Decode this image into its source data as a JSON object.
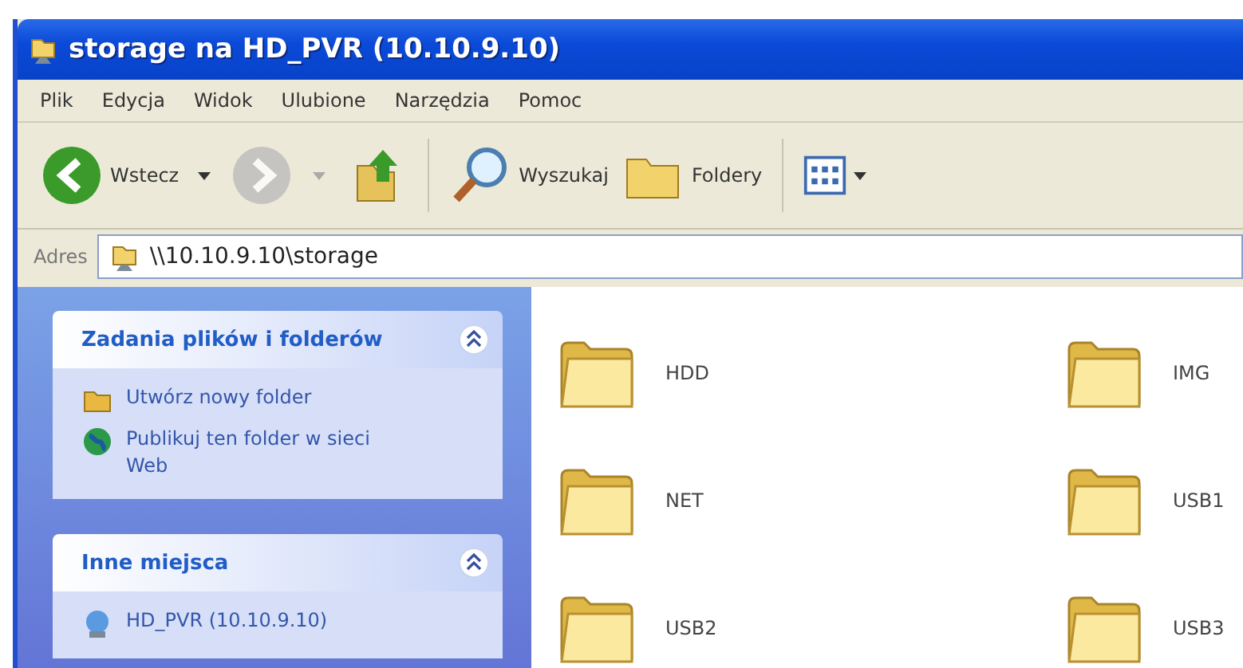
{
  "window": {
    "title": "storage na HD_PVR (10.10.9.10)"
  },
  "menu": [
    "Plik",
    "Edycja",
    "Widok",
    "Ulubione",
    "Narzędzia",
    "Pomoc"
  ],
  "toolbar": [
    {
      "kind": "back",
      "label": "Wstecz",
      "disabled": false
    },
    {
      "kind": "forward",
      "disabled": true
    },
    {
      "kind": "up",
      "disabled": false
    },
    {
      "kind": "separator"
    },
    {
      "kind": "search",
      "label": "Wyszukaj",
      "disabled": false
    },
    {
      "kind": "folders",
      "label": "Foldery",
      "disabled": false
    },
    {
      "kind": "separator"
    },
    {
      "kind": "views",
      "disabled": false
    }
  ],
  "address": {
    "label": "Adres",
    "value": "\\\\10.10.9.10\\storage"
  },
  "sidebar": {
    "panels": [
      {
        "title": "Zadania plików i folderów",
        "expanded": true,
        "items": [
          {
            "kind": "folder",
            "label": "Utwórz nowy folder"
          },
          {
            "kind": "globe",
            "label": "Publikuj ten folder w sieci Web"
          }
        ]
      },
      {
        "title": "Inne miejsca",
        "expanded": true,
        "items": [
          {
            "kind": "computer",
            "label": "HD_PVR (10.10.9.10)"
          }
        ]
      }
    ]
  },
  "folders": [
    {
      "name": "HDD"
    },
    {
      "name": "IMG"
    },
    {
      "name": "NET"
    },
    {
      "name": "USB1"
    },
    {
      "name": "USB2"
    },
    {
      "name": "USB3"
    }
  ]
}
